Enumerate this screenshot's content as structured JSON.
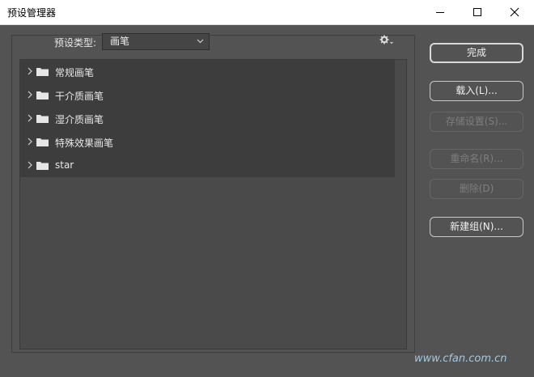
{
  "window": {
    "title": "预设管理器"
  },
  "preset_type": {
    "label": "预设类型:",
    "value": "画笔"
  },
  "list": {
    "items": [
      {
        "label": "常规画笔"
      },
      {
        "label": "干介质画笔"
      },
      {
        "label": "湿介质画笔"
      },
      {
        "label": "特殊效果画笔"
      },
      {
        "label": "star"
      }
    ]
  },
  "buttons": {
    "done": "完成",
    "load": "载入(L)...",
    "save": "存储设置(S)...",
    "rename": "重命名(R)...",
    "delete": "删除(D)",
    "new_group": "新建组(N)..."
  },
  "watermark": "www.cfan.com.cn",
  "icons": {
    "settings": "gear-icon",
    "folder": "folder-icon",
    "expand": "chevron-right-icon"
  },
  "colors": {
    "background": "#535353",
    "list_bg": "#4a4a4a",
    "row_bg": "#3d3d3d",
    "titlebar": "#ffffff"
  }
}
